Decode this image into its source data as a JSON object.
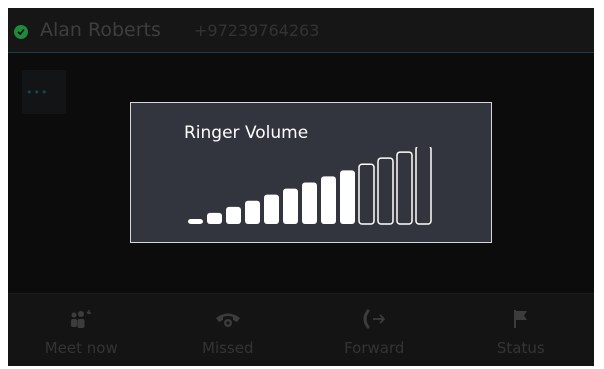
{
  "header": {
    "contact_name": "Alan Roberts",
    "contact_number": "+97239764263",
    "presence_color": "#1f8a3b",
    "presence_icon": "available-check-icon"
  },
  "active_call": {
    "icon": "more-dots-icon",
    "glyph": "•••"
  },
  "dialog": {
    "title": "Ringer Volume",
    "volume_level": 9,
    "volume_max": 13
  },
  "footer": {
    "items": [
      {
        "label": "Meet now",
        "icon": "meet-now-icon"
      },
      {
        "label": "Missed",
        "icon": "missed-call-icon"
      },
      {
        "label": "Forward",
        "icon": "forward-call-icon"
      },
      {
        "label": "Status",
        "icon": "status-flag-icon"
      }
    ]
  },
  "colors": {
    "screen_bg": "#0c0c0d",
    "dialog_bg": "#32353d",
    "bar_fill": "#ffffff"
  }
}
